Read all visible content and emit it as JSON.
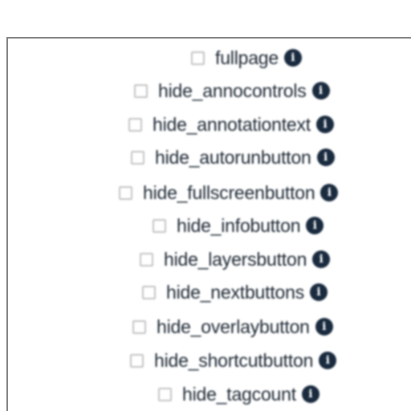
{
  "options": [
    {
      "label": "fullpage",
      "checked": false,
      "icon": "info-icon"
    },
    {
      "label": "hide_annocontrols",
      "checked": false,
      "icon": "info-icon"
    },
    {
      "label": "hide_annotationtext",
      "checked": false,
      "icon": "info-icon"
    },
    {
      "label": "hide_autorunbutton",
      "checked": false,
      "icon": "info-icon"
    },
    {
      "label": "hide_fullscreenbutton",
      "checked": false,
      "icon": "info-icon"
    },
    {
      "label": "hide_infobutton",
      "checked": false,
      "icon": "info-icon"
    },
    {
      "label": "hide_layersbutton",
      "checked": false,
      "icon": "info-icon"
    },
    {
      "label": "hide_nextbuttons",
      "checked": false,
      "icon": "info-icon"
    },
    {
      "label": "hide_overlaybutton",
      "checked": false,
      "icon": "info-icon"
    },
    {
      "label": "hide_shortcutbutton",
      "checked": false,
      "icon": "info-icon"
    },
    {
      "label": "hide_tagcount",
      "checked": false,
      "icon": "info-icon"
    }
  ],
  "info_glyph": "i",
  "colors": {
    "text": "#1c2733",
    "info_icon_bg": "#1a2b3f",
    "checkbox_border": "#c4c4c4",
    "panel_border": "#7d7d7d"
  }
}
